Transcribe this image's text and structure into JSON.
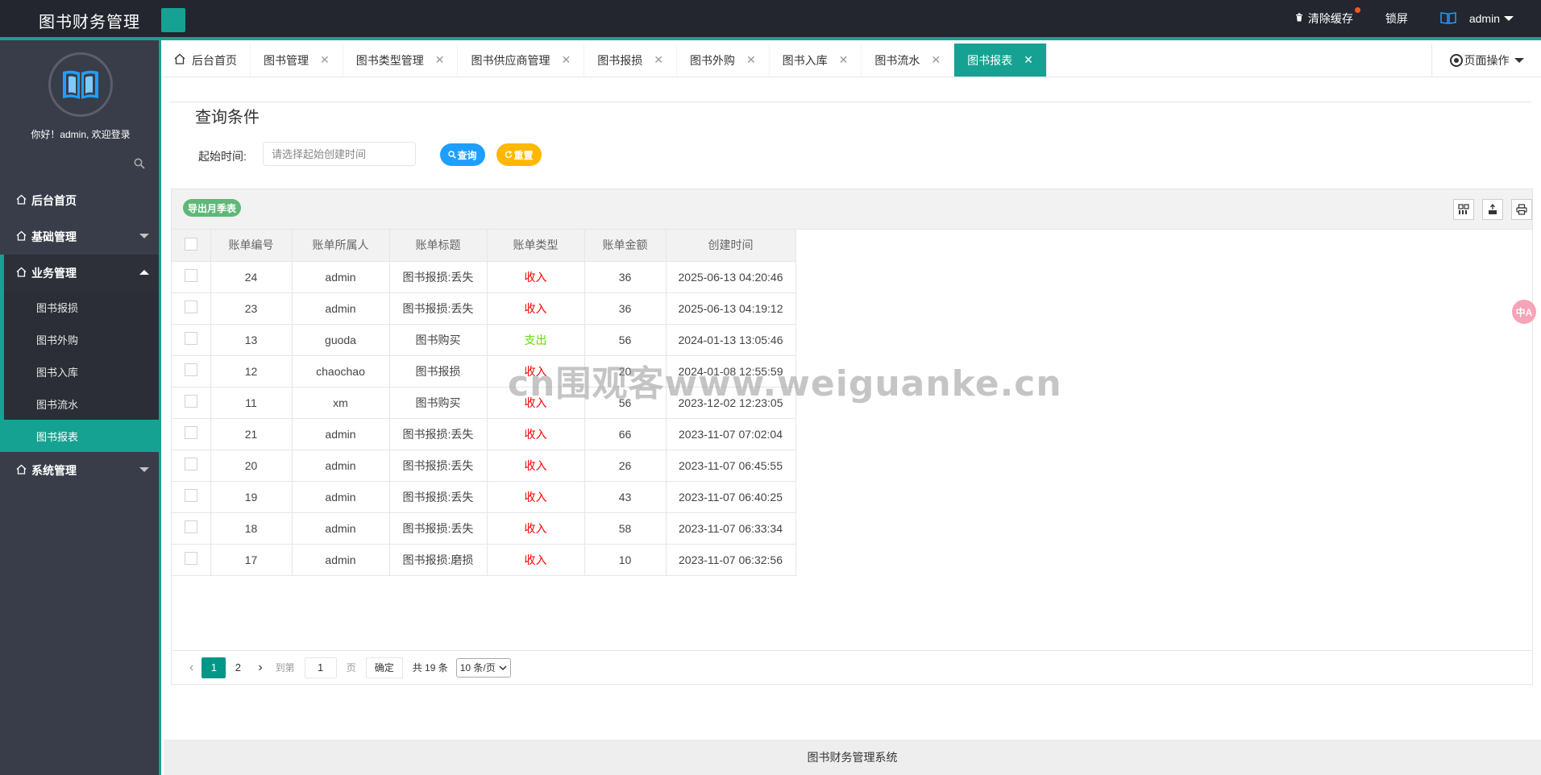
{
  "header": {
    "app_title": "图书财务管理",
    "clear_cache": "清除缓存",
    "lock_screen": "锁屏",
    "user": "admin"
  },
  "sidebar": {
    "welcome": "你好！admin, 欢迎登录",
    "menu": {
      "home": "后台首页",
      "basic": "基础管理",
      "business": "业务管理",
      "system": "系统管理"
    },
    "submenu": [
      "图书报损",
      "图书外购",
      "图书入库",
      "图书流水",
      "图书报表"
    ]
  },
  "tabs": [
    {
      "label": "后台首页"
    },
    {
      "label": "图书管理"
    },
    {
      "label": "图书类型管理"
    },
    {
      "label": "图书供应商管理"
    },
    {
      "label": "图书报损"
    },
    {
      "label": "图书外购"
    },
    {
      "label": "图书入库"
    },
    {
      "label": "图书流水"
    },
    {
      "label": "图书报表"
    }
  ],
  "page_ops": "页面操作",
  "query": {
    "legend": "查询条件",
    "start_label": "起始时间:",
    "start_placeholder": "请选择起始创建时间",
    "search_button": "查询",
    "reset_button": "重置"
  },
  "table": {
    "export_button": "导出月季表",
    "columns": [
      "账单编号",
      "账单所属人",
      "账单标题",
      "账单类型",
      "账单金额",
      "创建时间"
    ],
    "rows": [
      {
        "id": "24",
        "owner": "admin",
        "title": "图书报损:丢失",
        "type": "收入",
        "amount": "36",
        "time": "2025-06-13 04:20:46"
      },
      {
        "id": "23",
        "owner": "admin",
        "title": "图书报损:丢失",
        "type": "收入",
        "amount": "36",
        "time": "2025-06-13 04:19:12"
      },
      {
        "id": "13",
        "owner": "guoda",
        "title": "图书购买",
        "type": "支出",
        "amount": "56",
        "time": "2024-01-13 13:05:46"
      },
      {
        "id": "12",
        "owner": "chaochao",
        "title": "图书报损",
        "type": "收入",
        "amount": "20",
        "time": "2024-01-08 12:55:59"
      },
      {
        "id": "11",
        "owner": "xm",
        "title": "图书购买",
        "type": "收入",
        "amount": "56",
        "time": "2023-12-02 12:23:05"
      },
      {
        "id": "21",
        "owner": "admin",
        "title": "图书报损:丢失",
        "type": "收入",
        "amount": "66",
        "time": "2023-11-07 07:02:04"
      },
      {
        "id": "20",
        "owner": "admin",
        "title": "图书报损:丢失",
        "type": "收入",
        "amount": "26",
        "time": "2023-11-07 06:45:55"
      },
      {
        "id": "19",
        "owner": "admin",
        "title": "图书报损:丢失",
        "type": "收入",
        "amount": "43",
        "time": "2023-11-07 06:40:25"
      },
      {
        "id": "18",
        "owner": "admin",
        "title": "图书报损:丢失",
        "type": "收入",
        "amount": "58",
        "time": "2023-11-07 06:33:34"
      },
      {
        "id": "17",
        "owner": "admin",
        "title": "图书报损:磨损",
        "type": "收入",
        "amount": "10",
        "time": "2023-11-07 06:32:56"
      }
    ]
  },
  "pager": {
    "page1": "1",
    "page2": "2",
    "goto": "到第",
    "page_value": "1",
    "page_unit": "页",
    "confirm": "确定",
    "total": "共 19 条",
    "page_size": "10 条/页"
  },
  "watermark": "cn围观客www.weiguanke.cn",
  "translate_icon": "中A",
  "footer": "图书财务管理系统",
  "colors": {
    "accent": "#16a292",
    "header_bg": "#23262e",
    "sidebar_bg": "#393d49",
    "query_blue": "#1e9fff",
    "reset_yellow": "#ffb800",
    "export_green": "#5fb878",
    "income_red": "#ff0000",
    "expense_green": "#5fe000"
  }
}
